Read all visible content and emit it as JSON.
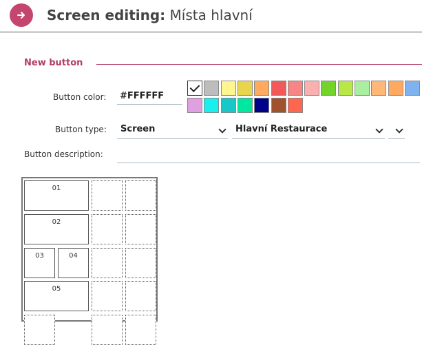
{
  "header": {
    "title_bold": "Screen editing:",
    "title_rest": " Místa hlavní"
  },
  "section": {
    "title": "New button"
  },
  "form": {
    "color_label": "Button color:",
    "color_value": "#FFFFFF",
    "type_label": "Button type:",
    "type_value": "Screen",
    "screen_value": "Hlavní Restaurace",
    "extra_value": "",
    "description_label": "Button description:",
    "description_value": ""
  },
  "palette": [
    "#FFFFFF",
    "#BDBDBD",
    "#FFF68F",
    "#E8D44D",
    "#FFAA5E",
    "#F05A5A",
    "#F78585",
    "#FBB0B0",
    "#72D42B",
    "#B7E848",
    "#A8F0A0",
    "#FFB878",
    "#FFA860",
    "#7FB3F0",
    "#E0A0E0",
    "#18F0F0",
    "#18C8C8",
    "#00E8A0",
    "#000088",
    "#A0522D",
    "#FF6650"
  ],
  "grid_buttons": [
    "01",
    "02",
    "03",
    "04",
    "05"
  ]
}
